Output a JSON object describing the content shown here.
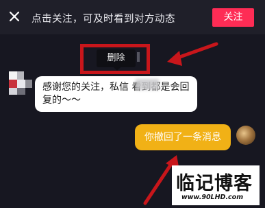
{
  "banner": {
    "text": "点击关注，可及时看到对方动态",
    "follow_label": "关注"
  },
  "context_menu": {
    "delete_label": "删除"
  },
  "messages": {
    "incoming_text": "感谢您的关注，私信 看到都是会回复的～～",
    "outgoing_text": "你撤回了一条消息"
  },
  "watermark": {
    "title": "临记博客",
    "url": "www.90LHD.com"
  },
  "colors": {
    "background": "#171721",
    "follow_button": "#fe2c55",
    "outgoing_bubble": "#f1b116",
    "annotation": "#c8161b"
  },
  "icons": {
    "close": "close-icon",
    "annotation_arrow": "red-arrow"
  }
}
